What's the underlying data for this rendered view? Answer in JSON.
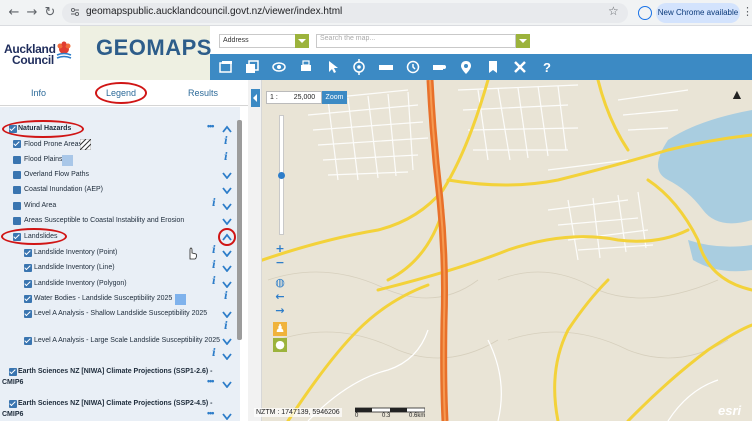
{
  "browser": {
    "url": "geomapspublic.aucklandcouncil.govt.nz/viewer/index.html",
    "chrome_button": "New Chrome available"
  },
  "header": {
    "logo_line1": "Auckland",
    "logo_line2": "Council",
    "app_title": "GEOMAPS",
    "address_select": "Address",
    "search_placeholder": "Search the map..."
  },
  "tabs": [
    "Info",
    "Legend",
    "Results"
  ],
  "legend": {
    "group": "Natural Hazards",
    "layers": [
      "Flood Prone Areas",
      "Flood Plains",
      "Overland Flow Paths",
      "Coastal Inundation (AEP)",
      "Wind Area",
      "Areas Susceptible to Coastal Instability and Erosion",
      "Landslides"
    ],
    "sublayers": [
      "Landslide Inventory (Point)",
      "Landslide Inventory (Line)",
      "Landslide Inventory (Polygon)",
      "Water Bodies - Landslide Susceptibility 2025",
      "Level A Analysis - Shallow Landslide Susceptibility 2025",
      "Level A Analysis - Large Scale Landslide Susceptibility 2025"
    ],
    "group2_line1": "Earth Sciences NZ [NIWA] Climate Projections (SSP1-2.6) -",
    "group2_line2": "CMIP6",
    "group3_line1": "Earth Sciences NZ [NIWA] Climate Projections (SSP2-4.5) -",
    "group3_line2": "CMIP6"
  },
  "map": {
    "scale_prefix": "1 :",
    "scale_value": "25,000",
    "zoom_button": "Zoom",
    "coords": "NZTM : 1747139, 5946206",
    "scale_labels": [
      "0",
      "0.3",
      "0.6km"
    ],
    "attribution": "esri"
  },
  "colors": {
    "accent": "#3c8ac4",
    "checkbox": "#3a75b0",
    "highlight": "#d01515",
    "motorway": "#e8702a",
    "road": "#f3d23a"
  }
}
